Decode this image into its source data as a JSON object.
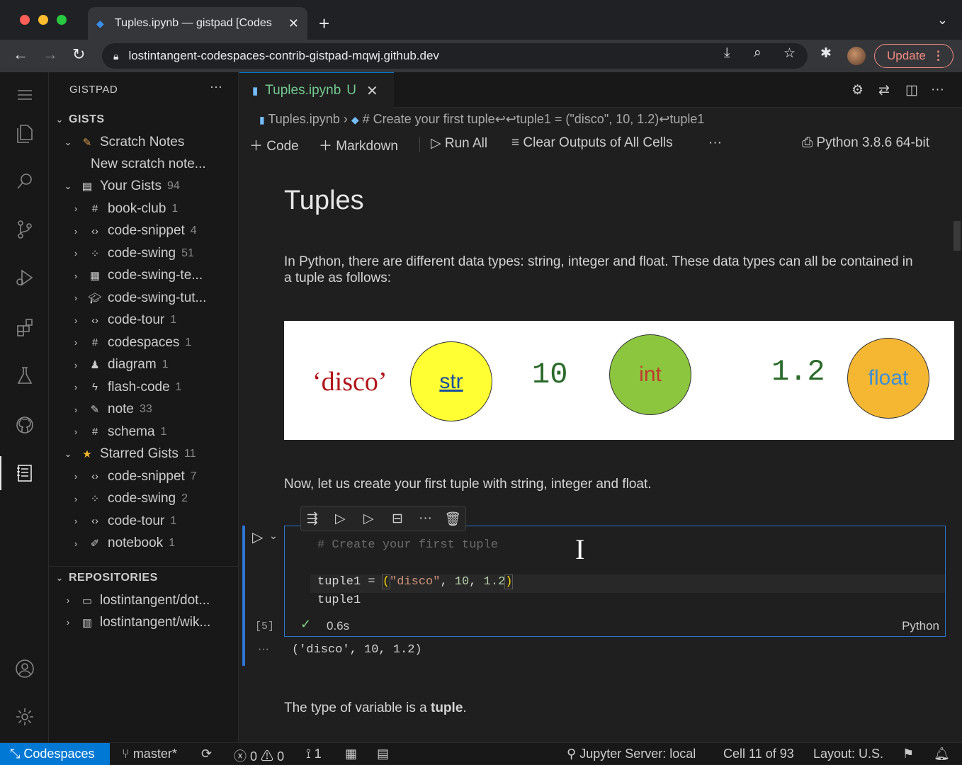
{
  "browser": {
    "tab_title": "Tuples.ipynb — gistpad [Codes",
    "url": "lostintangent-codespaces-contrib-gistpad-mqwj.github.dev",
    "update_label": "Update"
  },
  "sidebar": {
    "title": "GISTPAD",
    "gists_header": "GISTS",
    "scratch_notes": "Scratch Notes",
    "new_scratch": "New scratch note...",
    "your_gists": {
      "label": "Your Gists",
      "count": "94"
    },
    "your_gists_items": [
      {
        "label": "book-club",
        "count": "1",
        "icon": "hash-icon"
      },
      {
        "label": "code-snippet",
        "count": "4",
        "icon": "code-icon"
      },
      {
        "label": "code-swing",
        "count": "51",
        "icon": "swing-icon"
      },
      {
        "label": "code-swing-te...",
        "count": "",
        "icon": "template-icon"
      },
      {
        "label": "code-swing-tut...",
        "count": "",
        "icon": "tutorial-icon"
      },
      {
        "label": "code-tour",
        "count": "1",
        "icon": "code-icon"
      },
      {
        "label": "codespaces",
        "count": "1",
        "icon": "hash-icon"
      },
      {
        "label": "diagram",
        "count": "1",
        "icon": "diagram-icon"
      },
      {
        "label": "flash-code",
        "count": "1",
        "icon": "flash-icon"
      },
      {
        "label": "note",
        "count": "33",
        "icon": "pencil-icon"
      },
      {
        "label": "schema",
        "count": "1",
        "icon": "hash-icon"
      }
    ],
    "starred": {
      "label": "Starred Gists",
      "count": "11"
    },
    "starred_items": [
      {
        "label": "code-snippet",
        "count": "7",
        "icon": "code-icon"
      },
      {
        "label": "code-swing",
        "count": "2",
        "icon": "swing-icon"
      },
      {
        "label": "code-tour",
        "count": "1",
        "icon": "code-icon"
      },
      {
        "label": "notebook",
        "count": "1",
        "icon": "notebook-icon"
      }
    ],
    "repos_header": "REPOSITORIES",
    "repos": [
      "lostintangent/dot...",
      "lostintangent/wik..."
    ]
  },
  "editor": {
    "tab_label": "Tuples.ipynb",
    "tab_status": "U",
    "breadcrumb_file": "Tuples.ipynb",
    "breadcrumb_cell": "# Create your first tuple↩↩tuple1 = (\"disco\", 10, 1.2)↩tuple1",
    "toolbar": {
      "code": "Code",
      "markdown": "Markdown",
      "run_all": "Run All",
      "clear": "Clear Outputs of All Cells",
      "kernel": "Python 3.8.6 64-bit"
    }
  },
  "notebook": {
    "heading": "Tuples",
    "intro": "In Python, there are different data types: string, integer and float. These data types can all be contained in a tuple as follows:",
    "image": {
      "disco": "‘disco’",
      "str": "str",
      "ten": "10",
      "int": "int",
      "onetwo": "1.2",
      "float": "float"
    },
    "para2": "Now, let us create your first tuple with string, integer and float.",
    "cell": {
      "comment": "# Create your first tuple",
      "var": "tuple1",
      "eq": " = ",
      "open": "(",
      "s": "\"disco\"",
      "sep1": ", ",
      "n1": "10",
      "sep2": ", ",
      "n2": "1.2",
      "close": ")",
      "line3": "tuple1",
      "exec_count": "[5]",
      "duration": "0.6s",
      "language": "Python"
    },
    "output": "('disco', 10, 1.2)",
    "para3_prefix": "The type of variable is a ",
    "para3_bold": "tuple",
    "para3_suffix": "."
  },
  "statusbar": {
    "remote": "Codespaces",
    "branch": "master*",
    "errors": "0",
    "warnings": "0",
    "ports": "1",
    "jupyter": "Jupyter Server: local",
    "cell": "Cell 11 of 93",
    "layout": "Layout: U.S."
  }
}
